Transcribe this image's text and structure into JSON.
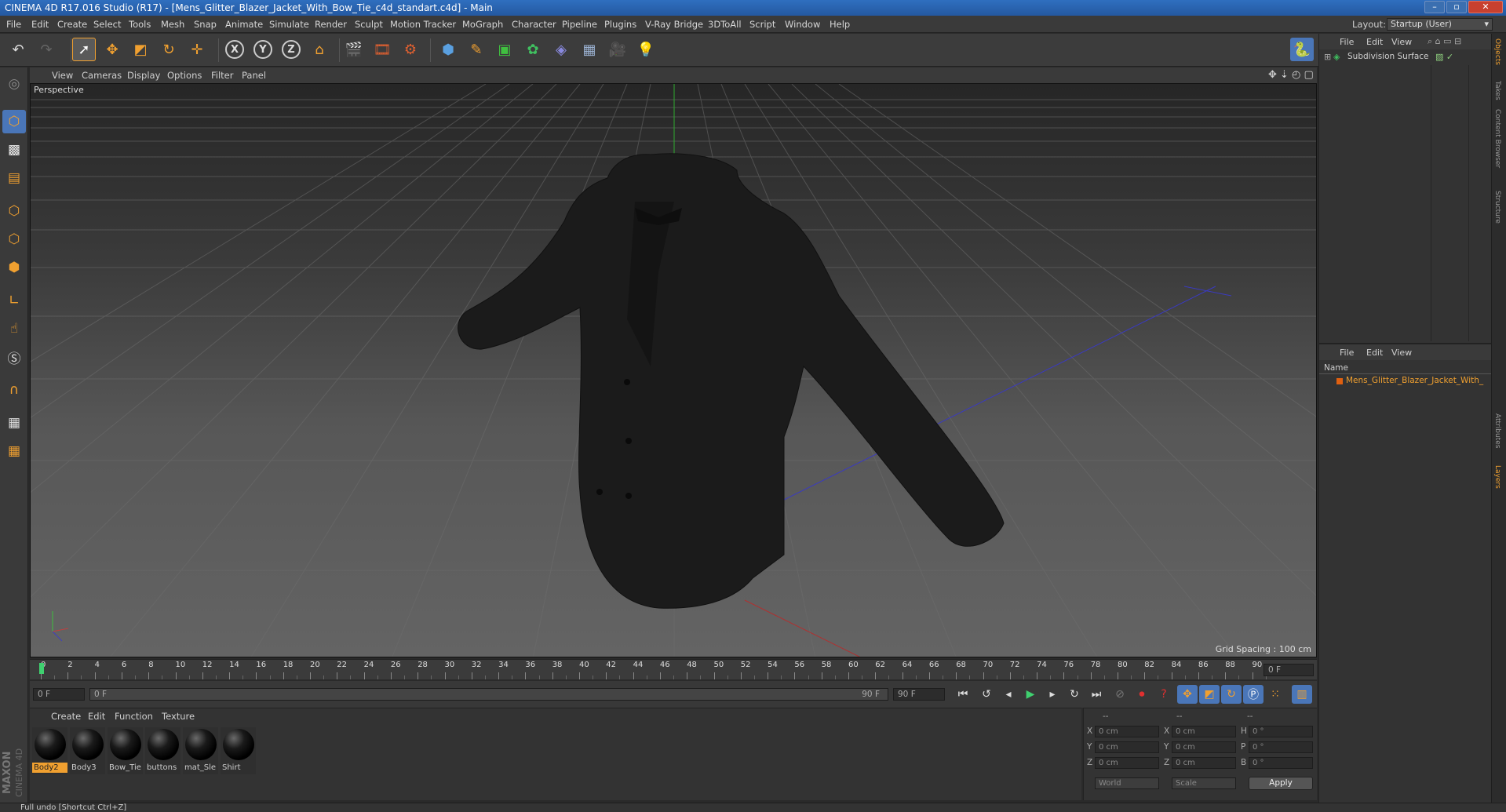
{
  "titlebar": {
    "title": "CINEMA 4D R17.016 Studio (R17) - [Mens_Glitter_Blazer_Jacket_With_Bow_Tie_c4d_standart.c4d] - Main",
    "minimize": "–",
    "maximize": "▫",
    "close": "✕"
  },
  "menubar": {
    "items": [
      "File",
      "Edit",
      "Create",
      "Select",
      "Tools",
      "Mesh",
      "Snap",
      "Animate",
      "Simulate",
      "Render",
      "Sculpt",
      "Motion Tracker",
      "MoGraph",
      "Character",
      "Pipeline",
      "Plugins",
      "V-Ray Bridge",
      "3DToAll",
      "Script",
      "Window",
      "Help"
    ],
    "layout_label": "Layout:",
    "layout_value": "Startup (User)"
  },
  "toolbar": {
    "icons": [
      "undo-icon",
      "redo-icon",
      "select-arrow-icon",
      "move-icon",
      "scale-icon",
      "rotate-icon",
      "live-select-icon",
      "x-axis-icon",
      "y-axis-icon",
      "z-axis-icon",
      "world-coord-icon",
      "render-view-icon",
      "render-picture-queue-icon",
      "render-settings-icon",
      "cube-primitive-icon",
      "pen-spline-icon",
      "subdivision-nurbs-icon",
      "cloner-mograph-icon",
      "deformer-icon",
      "floor-environment-icon",
      "camera-icon",
      "light-bulb-icon",
      "python-icon"
    ],
    "axis_labels": [
      "X",
      "Y",
      "Z"
    ]
  },
  "viewport": {
    "menu": [
      "View",
      "Cameras",
      "Display",
      "Options",
      "Filter",
      "Panel"
    ],
    "label": "Perspective",
    "grid_spacing": "Grid Spacing : 100 cm"
  },
  "timeline": {
    "ticks": [
      "0",
      "2",
      "4",
      "6",
      "8",
      "10",
      "12",
      "14",
      "16",
      "18",
      "20",
      "22",
      "24",
      "26",
      "28",
      "30",
      "32",
      "34",
      "36",
      "38",
      "40",
      "42",
      "44",
      "46",
      "48",
      "50",
      "52",
      "54",
      "56",
      "58",
      "60",
      "62",
      "64",
      "66",
      "68",
      "70",
      "72",
      "74",
      "76",
      "78",
      "80",
      "82",
      "84",
      "86",
      "88",
      "90"
    ],
    "current_frame": "0 F",
    "start_field": "0 F",
    "range_start": "0 F",
    "range_end": "90 F",
    "end_field": "90 F"
  },
  "playback": {
    "icons": [
      "go-start-icon",
      "prev-key-icon",
      "prev-frame-icon",
      "play-icon",
      "next-frame-icon",
      "next-key-icon",
      "go-end-icon",
      "record-keys-icon",
      "autokey-icon",
      "keyframe-selection-icon",
      "position-key-icon",
      "scale-key-icon",
      "rotation-key-icon",
      "param-key-icon",
      "pla-key-icon",
      "timeline-window-icon"
    ]
  },
  "material_manager": {
    "menu": [
      "Create",
      "Edit",
      "Function",
      "Texture"
    ],
    "materials": [
      "Body2",
      "Body3",
      "Bow_Tie",
      "buttons",
      "mat_Sle",
      "Shirt"
    ],
    "logo_line1": "MAXON",
    "logo_line2": "CINEMA 4D"
  },
  "coordinates": {
    "headers": [
      "--",
      "--",
      "--"
    ],
    "rows": [
      {
        "a": "X",
        "a_val": "0 cm",
        "b": "X",
        "b_val": "0 cm",
        "c": "H",
        "c_val": "0 °"
      },
      {
        "a": "Y",
        "a_val": "0 cm",
        "b": "Y",
        "b_val": "0 cm",
        "c": "P",
        "c_val": "0 °"
      },
      {
        "a": "Z",
        "a_val": "0 cm",
        "b": "Z",
        "b_val": "0 cm",
        "c": "B",
        "c_val": "0 °"
      }
    ],
    "mode_world": "World",
    "mode_scale": "Scale",
    "apply": "Apply"
  },
  "objects_panel": {
    "menu": [
      "File",
      "Edit",
      "View"
    ],
    "objects": [
      {
        "name": "Subdivision Surface"
      }
    ]
  },
  "layers_panel": {
    "menu": [
      "File",
      "Edit",
      "View"
    ],
    "column": "Name",
    "items": [
      "Mens_Glitter_Blazer_Jacket_With_"
    ]
  },
  "side_tabs": [
    "Objects",
    "Takes",
    "Content Browser",
    "Structure",
    "Attributes",
    "Layers"
  ],
  "status": {
    "text": "Full undo [Shortcut Ctrl+Z]"
  },
  "colors": {
    "accent_orange": "#f0a030",
    "title_blue": "#2f6fbf",
    "active_blue": "#4a76b8"
  }
}
